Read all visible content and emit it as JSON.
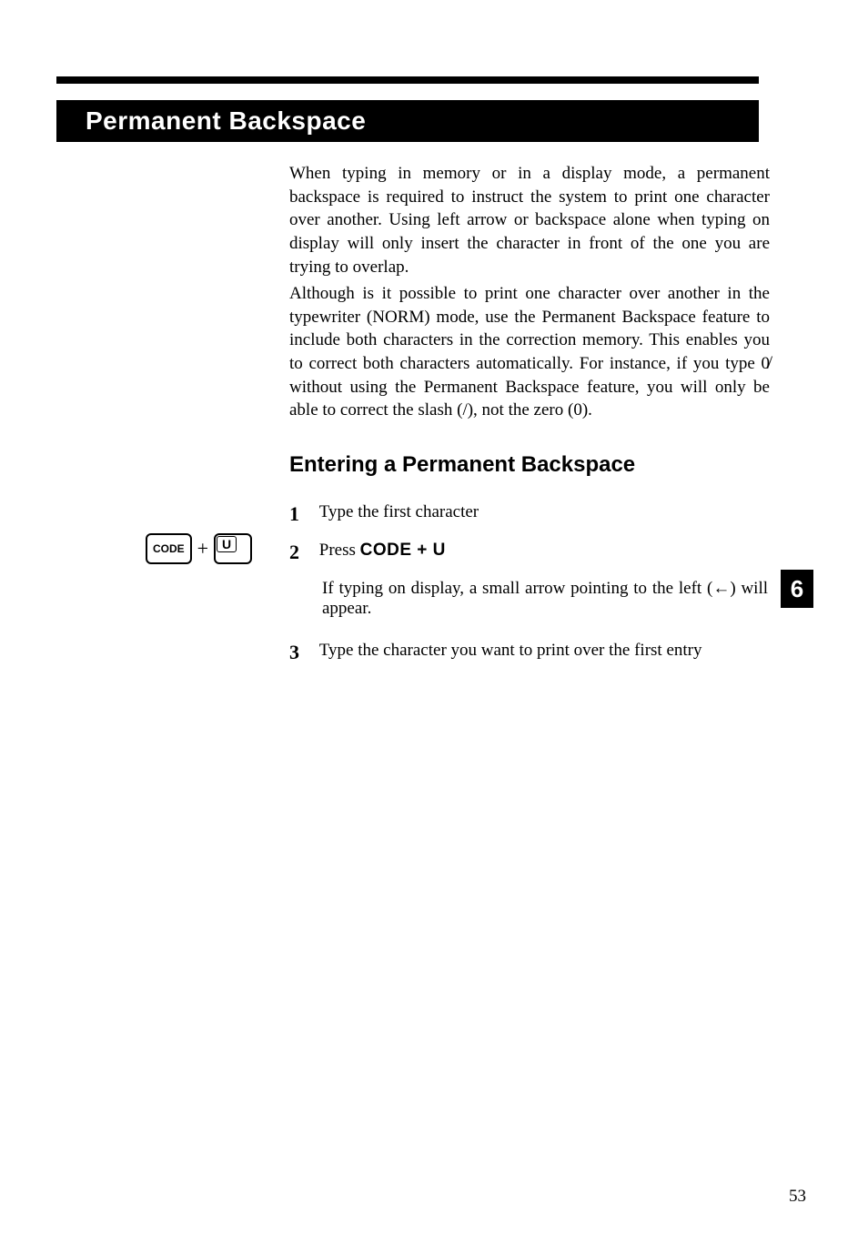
{
  "heading": "Permanent Backspace",
  "paragraphs": {
    "p1": "When typing in memory or in a display mode, a permanent backspace is required to instruct the system to print one character over another. Using left arrow or backspace alone when typing on display will only insert the character in front of the one you are trying to overlap.",
    "p2_a": "Although is it possible to print one character over another in the typewriter (NORM) mode, use the Permanent Backspace feature to include both characters in the correction memory. This enables you to correct both characters automatically. For instance, if you type ",
    "p2_zero": "0̸",
    "p2_b": " without using the Permanent Backspace feature, you will only be able to correct the slash (/), not the zero (0)."
  },
  "subheading": "Entering a Permanent Backspace",
  "steps": {
    "n1": "1",
    "t1": "Type the first character",
    "n2": "2",
    "t2_a": "Press ",
    "t2_b": "CODE + U",
    "detail": "If typing on display, a small arrow pointing to the left (←) will appear.",
    "n3": "3",
    "t3": "Type the character you want to print over the first entry"
  },
  "keys": {
    "code": "CODE",
    "plus": "+",
    "u": "U"
  },
  "tab": "6",
  "page_number": "53"
}
